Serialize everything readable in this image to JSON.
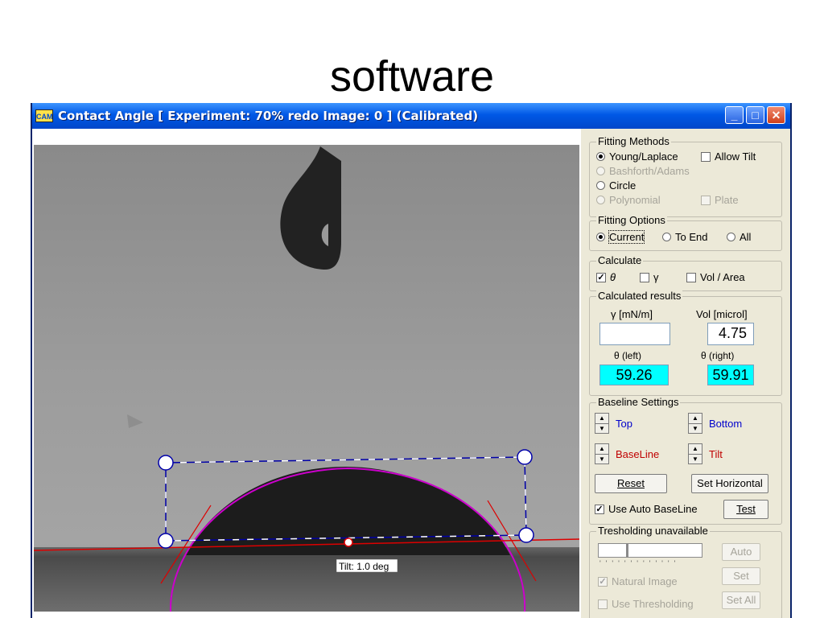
{
  "slide": {
    "title": "software"
  },
  "window": {
    "title": "Contact Angle [ Experiment: 70% redo  Image: 0 ]  (Calibrated)",
    "icon": "app-icon",
    "buttons": {
      "minimize": "_",
      "maximize": "□",
      "close": "✕"
    }
  },
  "image": {
    "tilt_label": "Tilt: 1.0 deg"
  },
  "panel": {
    "fitting_methods": {
      "legend": "Fitting Methods",
      "young_laplace": "Young/Laplace",
      "allow_tilt": "Allow Tilt",
      "bashforth_adams": "Bashforth/Adams",
      "circle": "Circle",
      "polynomial": "Polynomial",
      "plate": "Plate",
      "selected": "Young/Laplace"
    },
    "fitting_options": {
      "legend": "Fitting Options",
      "current": "Current",
      "to_end": "To End",
      "all": "All",
      "selected": "Current"
    },
    "calculate": {
      "legend": "Calculate",
      "theta": "θ",
      "gamma": "γ",
      "vol_area": "Vol / Area",
      "theta_checked": true
    },
    "results": {
      "legend": "Calculated results",
      "gamma_label": "γ [mN/m]",
      "vol_label": "Vol [microl]",
      "gamma_value": "",
      "vol_value": "4.75",
      "theta_left_label": "θ  (left)",
      "theta_right_label": "θ  (right)",
      "theta_left_value": "59.26",
      "theta_right_value": "59.91"
    },
    "baseline": {
      "legend": "Baseline Settings",
      "top": "Top",
      "bottom": "Bottom",
      "baseline": "BaseLine",
      "tilt": "Tilt",
      "reset": "Reset",
      "set_horizontal": "Set Horizontal",
      "use_auto": "Use Auto BaseLine",
      "test": "Test",
      "use_auto_checked": true
    },
    "threshold": {
      "legend": "Tresholding unavailable",
      "auto": "Auto",
      "set": "Set",
      "set_all": "Set All",
      "natural_image": "Natural Image",
      "use_thresholding": "Use Thresholding"
    }
  },
  "colors": {
    "titlebar": "#0058e6",
    "result_highlight": "#00ffff",
    "fit_curve": "#cc00cc",
    "tangent": "#dd0000",
    "box_outline": "#0000aa"
  }
}
